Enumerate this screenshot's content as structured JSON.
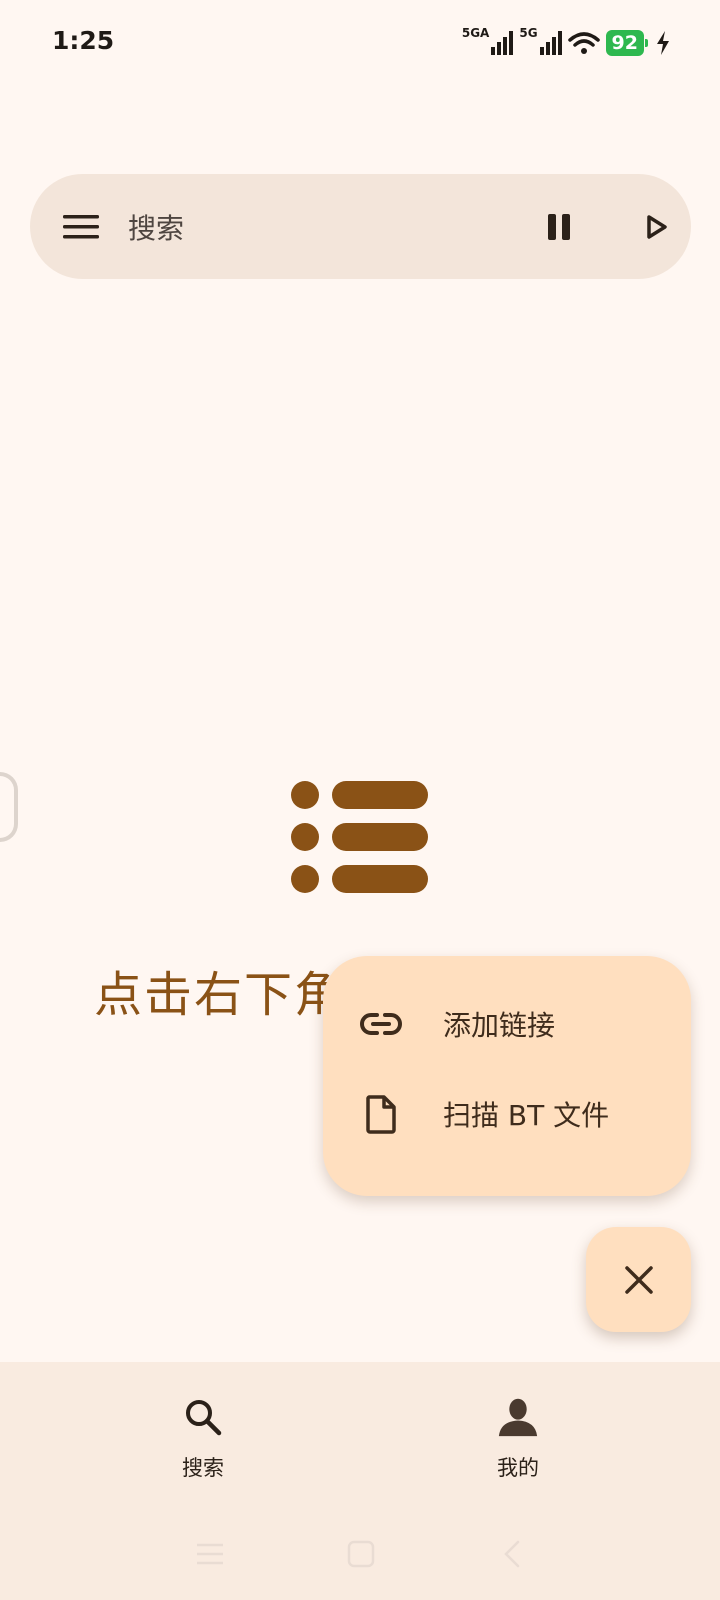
{
  "status_bar": {
    "time": "1:25",
    "signal1_label": "5GA",
    "signal2_label": "5G",
    "battery": "92"
  },
  "search_bar": {
    "placeholder": "搜索",
    "menu_icon": "menu-icon",
    "pause_icon": "pause-icon",
    "play_icon": "play-icon"
  },
  "empty_state": {
    "icon": "list-icon",
    "text": "点击右下角"
  },
  "fab_menu": {
    "items": [
      {
        "label": "添加链接",
        "icon": "link-icon"
      },
      {
        "label": "扫描 BT 文件",
        "icon": "file-icon"
      }
    ],
    "close_icon": "close-icon"
  },
  "bottom_nav": {
    "items": [
      {
        "label": "搜索",
        "icon": "search-icon"
      },
      {
        "label": "我的",
        "icon": "person-icon"
      }
    ]
  },
  "colors": {
    "background": "#fff7f2",
    "accent": "#8a5216",
    "fab": "#ffdfbf",
    "search_bar": "#f3e5da",
    "nav_bar": "#f9ebe0"
  }
}
